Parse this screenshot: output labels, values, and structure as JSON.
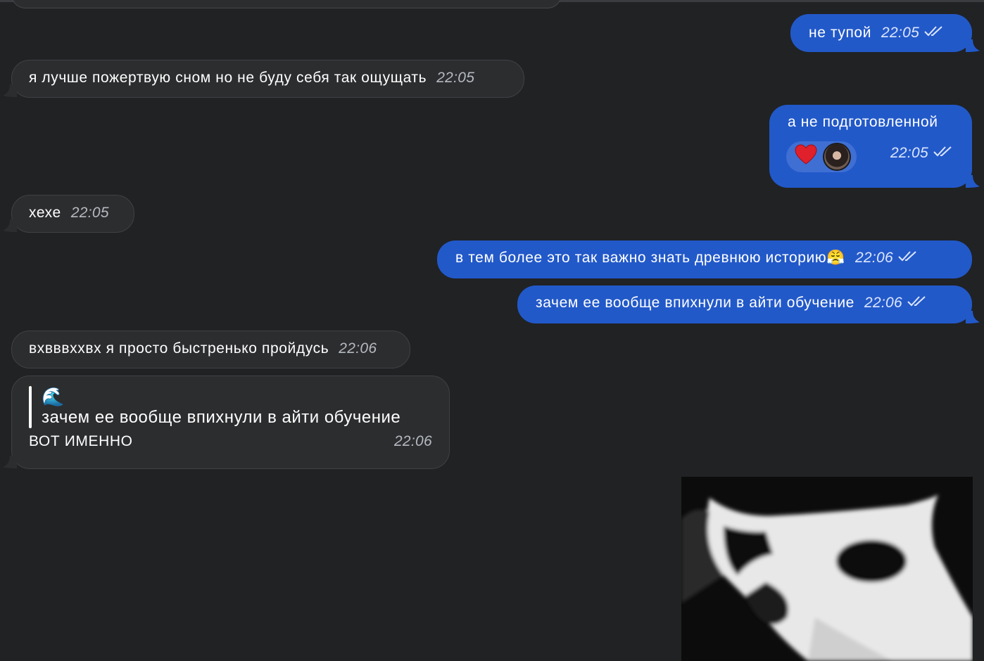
{
  "messages": [
    {
      "id": "m1",
      "side": "out",
      "text": "не тупой",
      "time": "22:05",
      "read": true
    },
    {
      "id": "m2",
      "side": "in",
      "text": "я лучше пожертвую сном но не буду себя так ощущать",
      "time": "22:05"
    },
    {
      "id": "m3",
      "side": "out",
      "text": "а не подготовленной",
      "time": "22:05",
      "read": true,
      "reaction": {
        "emoji": "♥️",
        "icon": "heart-icon"
      }
    },
    {
      "id": "m4",
      "side": "in",
      "text": "хехе",
      "time": "22:05"
    },
    {
      "id": "m5",
      "side": "out",
      "text": "в тем более это так важно знать древнюю историю😤",
      "time": "22:06",
      "read": true
    },
    {
      "id": "m6",
      "side": "out",
      "text": "зачем ее вообще впихнули в айти обучение",
      "time": "22:06",
      "read": true
    },
    {
      "id": "m7",
      "side": "in",
      "text": "вхвввххвх я просто быстренько пройдусь",
      "time": "22:06"
    },
    {
      "id": "m8",
      "side": "in",
      "reply_to": {
        "emoji": "🌊",
        "text": "зачем ее вообще впихнули в айти обучение"
      },
      "text": "ВОТ ИМЕННО",
      "time": "22:06"
    }
  ],
  "colors": {
    "background": "#202224",
    "incoming_bubble": "#2c2d2f",
    "outgoing_bubble": "#2259c9",
    "time_incoming": "#b5b9c0",
    "time_outgoing": "#dce6ff"
  },
  "media": {
    "type": "image",
    "icon": "cat-photo"
  }
}
